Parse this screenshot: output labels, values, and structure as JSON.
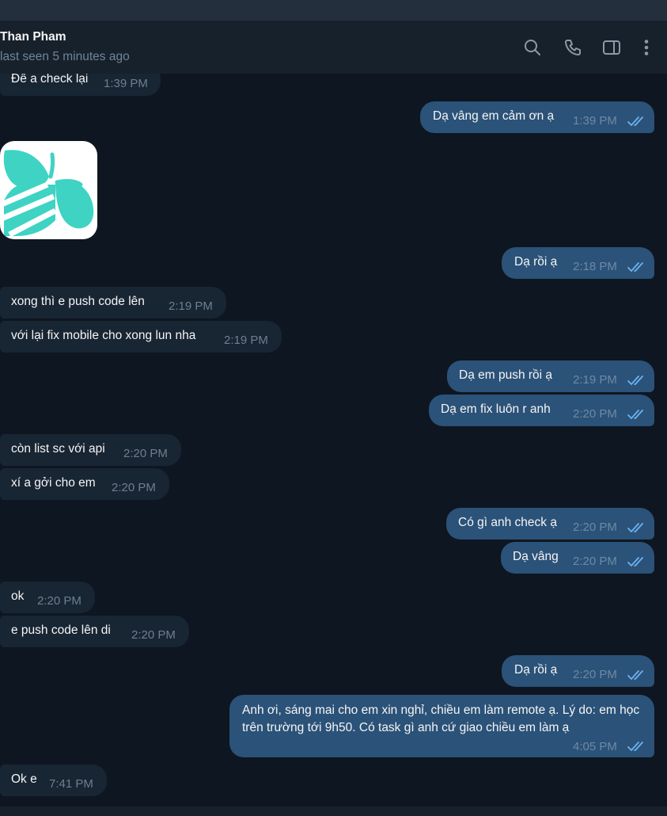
{
  "header": {
    "contact_name": "Than Pham",
    "status": "last seen 5 minutes ago",
    "icons": [
      "search-icon",
      "phone-icon",
      "sidebar-toggle-icon",
      "more-vertical-icon"
    ]
  },
  "colors": {
    "background": "#0e1621",
    "header": "#17212b",
    "incoming_bubble": "#182533",
    "outgoing_bubble": "#2b5278",
    "read_ticks": "#6cb3f3"
  },
  "messages": [
    {
      "dir": "in",
      "text": "Để a check lại",
      "time": "1:39 PM"
    },
    {
      "dir": "out",
      "text": "Dạ vâng em cảm ơn ạ",
      "time": "1:39 PM",
      "read": true
    },
    {
      "dir": "in",
      "type": "sticker",
      "sticker": "bee-logo"
    },
    {
      "dir": "out",
      "text": "Dạ rồi ạ",
      "time": "2:18 PM",
      "read": true
    },
    {
      "dir": "in",
      "text": "xong thì e push code lên",
      "time": "2:19 PM"
    },
    {
      "dir": "in",
      "text": "với lại fix mobile cho xong lun nha",
      "time": "2:19 PM"
    },
    {
      "dir": "out",
      "text": "Dạ em push rồi ạ",
      "time": "2:19 PM",
      "read": true
    },
    {
      "dir": "out",
      "text": "Dạ em fix luôn r anh",
      "time": "2:20 PM",
      "read": true
    },
    {
      "dir": "in",
      "text": "còn list sc với api",
      "time": "2:20 PM"
    },
    {
      "dir": "in",
      "text": "xí a gởi cho em",
      "time": "2:20 PM"
    },
    {
      "dir": "out",
      "text": "Có gì anh check ạ",
      "time": "2:20 PM",
      "read": true
    },
    {
      "dir": "out",
      "text": "Dạ vâng",
      "time": "2:20 PM",
      "read": true
    },
    {
      "dir": "in",
      "text": "ok",
      "time": "2:20 PM"
    },
    {
      "dir": "in",
      "text": "e push code lên di",
      "time": "2:20 PM"
    },
    {
      "dir": "out",
      "text": "Dạ rồi ạ",
      "time": "2:20 PM",
      "read": true
    },
    {
      "dir": "out",
      "text": "Anh ơi, sáng  mai cho em xin nghỉ, chiều em làm remote ạ. Lý do: em học trên trường tới 9h50. Có task gì anh cứ giao chiều em làm ạ",
      "time": "4:05 PM",
      "read": true
    },
    {
      "dir": "in",
      "text": "Ok e",
      "time": "7:41 PM"
    }
  ]
}
